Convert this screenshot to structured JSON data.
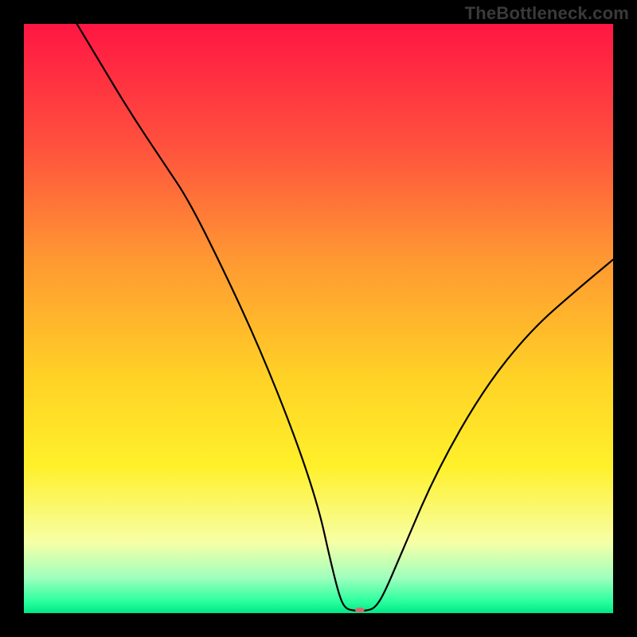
{
  "watermark": "TheBottleneck.com",
  "chart_data": {
    "type": "line",
    "title": "",
    "xlabel": "",
    "ylabel": "",
    "xlim": [
      0,
      100
    ],
    "ylim": [
      0,
      100
    ],
    "background_gradient": {
      "direction": "vertical",
      "stops": [
        {
          "pct": 0,
          "color": "#ff1643"
        },
        {
          "pct": 20,
          "color": "#ff4f3e"
        },
        {
          "pct": 40,
          "color": "#ff9832"
        },
        {
          "pct": 60,
          "color": "#ffd226"
        },
        {
          "pct": 75,
          "color": "#fff02a"
        },
        {
          "pct": 88,
          "color": "#f7ffa6"
        },
        {
          "pct": 94,
          "color": "#9fffbe"
        },
        {
          "pct": 98,
          "color": "#2bff9e"
        },
        {
          "pct": 100,
          "color": "#00e887"
        }
      ]
    },
    "marker": {
      "x": 57,
      "y": 0,
      "color": "#d9676c",
      "rx": 6,
      "ry": 3
    },
    "series": [
      {
        "name": "curve",
        "color": "#000000",
        "points": [
          {
            "x": 9,
            "y": 100
          },
          {
            "x": 12,
            "y": 95
          },
          {
            "x": 18,
            "y": 85
          },
          {
            "x": 24,
            "y": 76
          },
          {
            "x": 28,
            "y": 70
          },
          {
            "x": 34,
            "y": 58
          },
          {
            "x": 40,
            "y": 45
          },
          {
            "x": 46,
            "y": 30
          },
          {
            "x": 50,
            "y": 18
          },
          {
            "x": 52,
            "y": 9
          },
          {
            "x": 53.5,
            "y": 3
          },
          {
            "x": 54.5,
            "y": 0.8
          },
          {
            "x": 56,
            "y": 0.4
          },
          {
            "x": 58,
            "y": 0.4
          },
          {
            "x": 59.5,
            "y": 0.8
          },
          {
            "x": 61,
            "y": 3
          },
          {
            "x": 64,
            "y": 10
          },
          {
            "x": 70,
            "y": 24
          },
          {
            "x": 78,
            "y": 38
          },
          {
            "x": 86,
            "y": 48
          },
          {
            "x": 94,
            "y": 55
          },
          {
            "x": 100,
            "y": 60
          }
        ]
      }
    ]
  }
}
